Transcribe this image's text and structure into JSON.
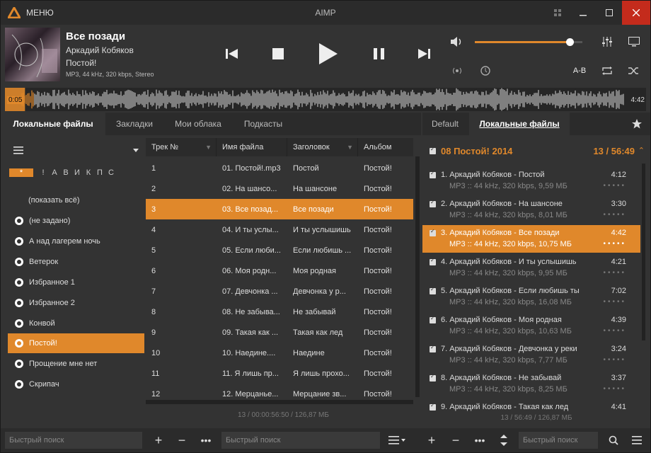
{
  "window": {
    "title": "AIMP",
    "menu_label": "МЕНЮ"
  },
  "now_playing": {
    "title": "Все позади",
    "artist": "Аркадий Кобяков",
    "album": "Постой!",
    "info": "MP3, 44 kHz, 320 kbps, Stereo",
    "time_current": "0:05",
    "time_total": "4:42",
    "volume_fraction": 0.88,
    "position_fraction": 0.018
  },
  "controls": {
    "ab_label": "A-B"
  },
  "tabs_left": [
    "Локальные файлы",
    "Закладки",
    "Мои облака",
    "Подкасты"
  ],
  "tabs_right": [
    "Default",
    "Локальные файлы"
  ],
  "alphabet": [
    "*",
    "!",
    "А",
    "В",
    "И",
    "К",
    "П",
    "С"
  ],
  "groups": [
    "(показать всё)",
    "(не задано)",
    "А над лагерем ночь",
    "Ветерок",
    "Избранное 1",
    "Избранное 2",
    "Конвой",
    "Постой!",
    "Прощение мне нет",
    "Скрипач"
  ],
  "table": {
    "headers": [
      "Трек №",
      "Имя файла",
      "Заголовок",
      "Альбом"
    ],
    "rows": [
      [
        "1",
        "01. Постой!.mp3",
        "Постой",
        "Постой!"
      ],
      [
        "2",
        "02. На шансо...",
        "На шансоне",
        "Постой!"
      ],
      [
        "3",
        "03. Все позад...",
        "Все позади",
        "Постой!"
      ],
      [
        "4",
        "04. И ты услы...",
        "И ты услышишь",
        "Постой!"
      ],
      [
        "5",
        "05. Если люби...",
        "Если любишь ...",
        "Постой!"
      ],
      [
        "6",
        "06. Моя родн...",
        "Моя родная",
        "Постой!"
      ],
      [
        "7",
        "07. Девчонка ...",
        "Девчонка у р...",
        "Постой!"
      ],
      [
        "8",
        "08. Не забыва...",
        "Не забывай",
        "Постой!"
      ],
      [
        "9",
        "09. Такая как ...",
        "Такая как лед",
        "Постой!"
      ],
      [
        "10",
        "10. Наедине....",
        "Наедине",
        "Постой!"
      ],
      [
        "11",
        "11. Я лишь пр...",
        "Я лишь прохо...",
        "Постой!"
      ],
      [
        "12",
        "12. Мерцанье...",
        "Мерцание зв...",
        "Постой!"
      ]
    ],
    "footer": "13 / 00:00:56:50 / 126,87 МБ"
  },
  "playlist": {
    "group_title": "08 Постой! 2014",
    "group_summary": "13 / 56:49",
    "items": [
      {
        "title": "1. Аркадий Кобяков - Постой",
        "info": "MP3 :: 44 kHz, 320 kbps, 9,59 МБ",
        "duration": "4:12"
      },
      {
        "title": "2. Аркадий Кобяков - На шансоне",
        "info": "MP3 :: 44 kHz, 320 kbps, 8,01 МБ",
        "duration": "3:30"
      },
      {
        "title": "3. Аркадий Кобяков - Все позади",
        "info": "MP3 :: 44 kHz, 320 kbps, 10,75 МБ",
        "duration": "4:42"
      },
      {
        "title": "4. Аркадий Кобяков - И ты услышишь",
        "info": "MP3 :: 44 kHz, 320 kbps, 9,95 МБ",
        "duration": "4:21"
      },
      {
        "title": "5. Аркадий Кобяков - Если любишь ты",
        "info": "MP3 :: 44 kHz, 320 kbps, 16,08 МБ",
        "duration": "7:02"
      },
      {
        "title": "6. Аркадий Кобяков - Моя родная",
        "info": "MP3 :: 44 kHz, 320 kbps, 10,63 МБ",
        "duration": "4:39"
      },
      {
        "title": "7. Аркадий Кобяков - Девчонка у реки",
        "info": "MP3 :: 44 kHz, 320 kbps, 7,77 МБ",
        "duration": "3:24"
      },
      {
        "title": "8. Аркадий Кобяков - Не забывай",
        "info": "MP3 :: 44 kHz, 320 kbps, 8,25 МБ",
        "duration": "3:37"
      },
      {
        "title": "9. Аркадий Кобяков - Такая как лед",
        "info": "",
        "duration": "4:41"
      }
    ],
    "footer": "13 / 56:49 / 126,87 МБ"
  },
  "search": {
    "placeholder": "Быстрый поиск"
  },
  "colors": {
    "accent": "#e0882b",
    "background": "#333333"
  }
}
